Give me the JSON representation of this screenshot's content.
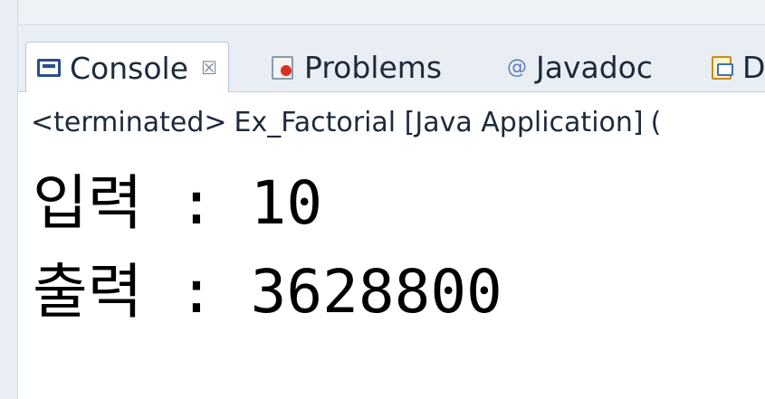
{
  "tabs": [
    {
      "label": "Console",
      "icon": "console-icon",
      "active": true,
      "close_symbol": "☒"
    },
    {
      "label": "Problems",
      "icon": "problems-icon",
      "active": false
    },
    {
      "label": "Javadoc",
      "icon": "at-icon",
      "icon_glyph": "@",
      "active": false
    },
    {
      "label": "D",
      "icon": "declaration-icon",
      "active": false
    }
  ],
  "status": {
    "state": "<terminated>",
    "launch": "Ex_Factorial [Java Application]",
    "trailing": "("
  },
  "console": {
    "lines": [
      "입력 : 10",
      "출력 : 3628800"
    ]
  },
  "colors": {
    "tab_bar_bg": "#e9eef5",
    "active_tab_bg": "#ffffff",
    "console_icon": "#2a4d8f",
    "text": "#000000"
  }
}
